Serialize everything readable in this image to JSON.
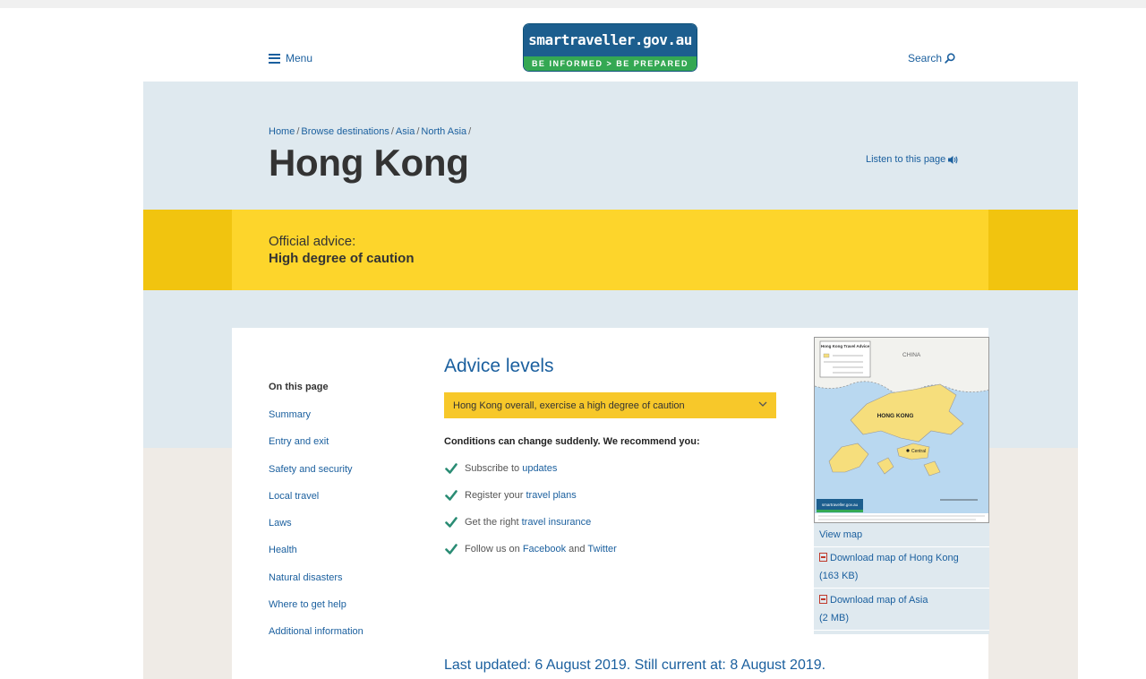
{
  "header": {
    "menu_label": "Menu",
    "logo_top": "smartraveller.gov.au",
    "logo_bottom": "BE INFORMED  >  BE PREPARED",
    "search_label": "Search"
  },
  "breadcrumb": [
    "Home",
    "Browse destinations",
    "Asia",
    "North Asia"
  ],
  "page_title": "Hong Kong",
  "listen_label": "Listen to this page",
  "advice": {
    "label": "Official advice:",
    "value": "High degree of caution"
  },
  "nav": {
    "title": "On this page",
    "items": [
      "Summary",
      "Entry and exit",
      "Safety and security",
      "Local travel",
      "Laws",
      "Health",
      "Natural disasters",
      "Where to get help",
      "Additional information"
    ]
  },
  "advice_levels": {
    "title": "Advice levels",
    "dropdown_value": "Hong Kong overall, exercise a high degree of caution",
    "conditions": "Conditions can change suddenly. We recommend you:",
    "items": [
      {
        "prefix": "Subscribe to ",
        "link": "updates",
        "middle": "",
        "link2": ""
      },
      {
        "prefix": "Register your ",
        "link": "travel plans",
        "middle": "",
        "link2": ""
      },
      {
        "prefix": "Get the right ",
        "link": "travel insurance",
        "middle": "",
        "link2": ""
      },
      {
        "prefix": "Follow us on ",
        "link": "Facebook",
        "middle": " and ",
        "link2": "Twitter"
      }
    ]
  },
  "map": {
    "legend_title": "Hong Kong Travel Advice",
    "china_label": "CHINA",
    "hk_label": "HONG KONG",
    "central_label": "Central",
    "brand": "smartraveller.gov.au"
  },
  "sidebar": {
    "view_map": "View map",
    "dl_hk": "Download map of Hong Kong",
    "dl_hk_size": "(163 KB)",
    "dl_asia": "Download map of Asia",
    "dl_asia_size": "(2 MB)"
  },
  "last_updated": "Last updated: 6 August 2019. Still current at: 8 August 2019.",
  "colors": {
    "link": "#1a5f9e",
    "hero_bg": "#dfe9ef",
    "advice_band": "#fdd52b",
    "advice_band_edge": "#f1c40f",
    "dropdown_bg": "#f7c82a",
    "check": "#2a8c74"
  }
}
